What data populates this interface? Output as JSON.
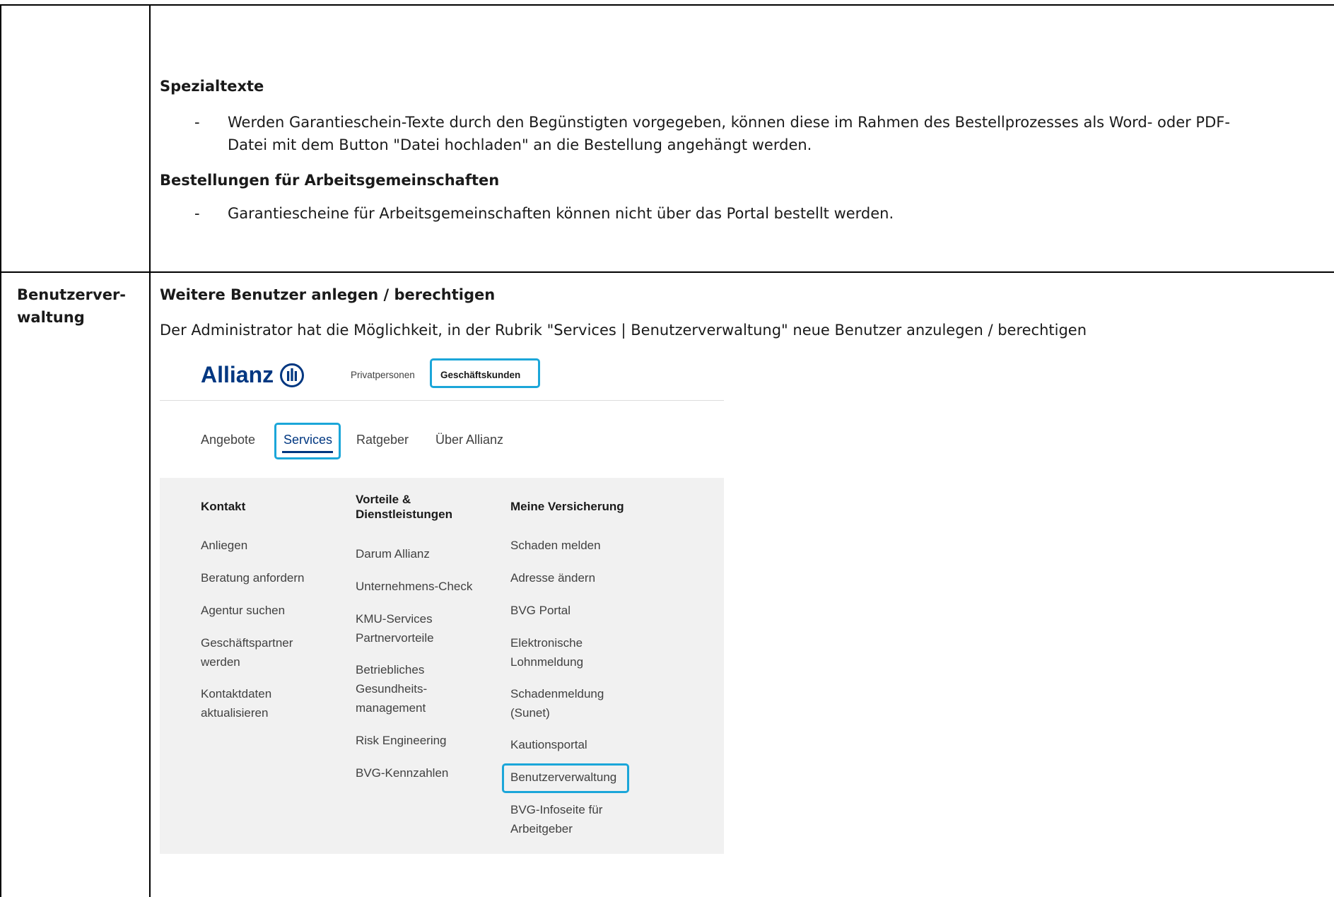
{
  "row1": {
    "heading_spezial": "Spezialtexte",
    "dash": "-",
    "spezial_line1": "Werden Garantieschein-Texte durch den Begünstigten vorgegeben, können diese im Rahmen des Bestellprozesses als Word- oder PDF-",
    "spezial_line2": "Datei mit dem Button \"Datei hochladen\" an die Bestellung angehängt werden.",
    "heading_arge": "Bestellungen für Arbeitsgemeinschaften",
    "arge_line": "Garantiescheine für Arbeitsgemeinschaften können nicht über das Portal bestellt werden."
  },
  "row2": {
    "label_line1": "Benutzerver-",
    "label_line2": "waltung",
    "heading": "Weitere Benutzer anlegen / berechtigen",
    "text": "Der Administrator hat die Möglichkeit, in der Rubrik \"Services | Benutzerverwaltung\" neue Benutzer anzulegen / berechtigen"
  },
  "screenshot": {
    "logo_text": "Allianz",
    "top_tabs": [
      "Privatpersonen",
      "Geschäftskunden"
    ],
    "nav": [
      "Angebote",
      "Services",
      "Ratgeber",
      "Über Allianz"
    ],
    "columns": [
      {
        "title": "Kontakt",
        "items": [
          "Anliegen",
          "Beratung anfordern",
          "Agentur suchen",
          "Geschäftspartner werden",
          "Kontaktdaten aktualisieren"
        ]
      },
      {
        "title": "Vorteile & Dienstleistungen",
        "items": [
          "Darum Allianz",
          "Unternehmens-Check",
          "KMU-Services Partnervorteile",
          "Betriebliches Gesundheits-management",
          "Risk Engineering",
          "BVG-Kennzahlen"
        ]
      },
      {
        "title": "Meine Versicherung",
        "items": [
          "Schaden melden",
          "Adresse ändern",
          "BVG Portal",
          "Elektronische Lohnmeldung",
          "Schadenmeldung (Sunet)",
          "Kautionsportal",
          "Benutzerverwaltung",
          "BVG-Infoseite für Arbeitgeber"
        ]
      }
    ],
    "colors": {
      "brand": "#003781",
      "highlight": "#1ba6d9",
      "panel": "#f1f1f1"
    }
  }
}
